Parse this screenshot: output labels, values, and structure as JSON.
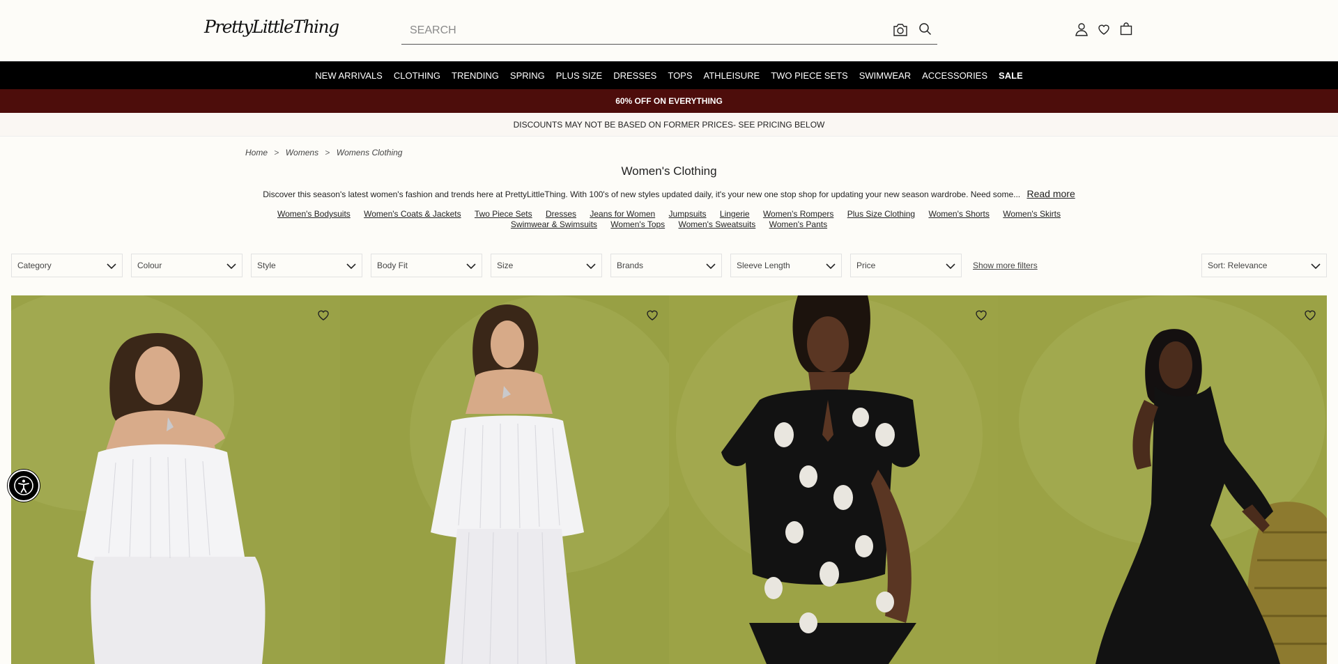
{
  "header": {
    "logo": "PrettyLittleThing",
    "search_placeholder": "SEARCH"
  },
  "nav": {
    "items": [
      "NEW ARRIVALS",
      "CLOTHING",
      "TRENDING",
      "SPRING",
      "PLUS SIZE",
      "DRESSES",
      "TOPS",
      "ATHLEISURE",
      "TWO PIECE SETS",
      "SWIMWEAR",
      "ACCESSORIES",
      "SALE"
    ]
  },
  "promo": "60% OFF ON EVERYTHING",
  "notice": "DISCOUNTS MAY NOT BE BASED ON FORMER PRICES- SEE PRICING BELOW",
  "breadcrumb": [
    "Home",
    "Womens",
    "Womens Clothing"
  ],
  "breadcrumb_sep": ">",
  "page_title": "Women's Clothing",
  "intro": {
    "text": "Discover this season's latest women's fashion and trends here at PrettyLittleThing. With 100's of new styles updated daily, it's your new one stop shop for updating your new season wardrobe. Need some...",
    "read_more": "Read more"
  },
  "categories": [
    "Women's Bodysuits",
    "Women's Coats & Jackets",
    "Two Piece Sets",
    "Dresses",
    "Jeans for Women",
    "Jumpsuits",
    "Lingerie",
    "Women's Rompers",
    "Plus Size Clothing",
    "Women's Shorts",
    "Women's Skirts",
    "Swimwear & Swimsuits",
    "Women's Tops",
    "Women's Sweatsuits",
    "Women's Pants"
  ],
  "filters": [
    "Category",
    "Colour",
    "Style",
    "Body Fit",
    "Size",
    "Brands",
    "Sleeve Length",
    "Price"
  ],
  "show_more_filters": "Show more filters",
  "sort": "Sort: Relevance",
  "colors": {
    "nav_bg": "#000000",
    "promo_bg": "#4d0d0b",
    "product_bg": "#9aa247"
  },
  "products": [
    {
      "icon": "heart-icon",
      "outfit": "white pleated bandeau two piece"
    },
    {
      "icon": "heart-icon",
      "outfit": "white pleated bandeau two piece"
    },
    {
      "icon": "heart-icon",
      "outfit": "black polka dot puff sleeve romper"
    },
    {
      "icon": "heart-icon",
      "outfit": "black halter maxi dress"
    }
  ]
}
